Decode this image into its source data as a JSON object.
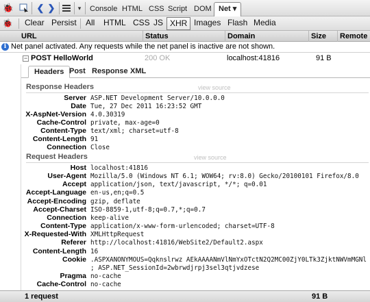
{
  "toolbar": {
    "panels": [
      "Console",
      "HTML",
      "CSS",
      "Script",
      "DOM"
    ],
    "active_panel": "Net",
    "active_panel_arrow": "▾",
    "icons": [
      "firebug-icon",
      "inspect-icon",
      "back-icon",
      "forward-icon",
      "menu-icon",
      "dropdown-icon"
    ]
  },
  "filters": {
    "clear": "Clear",
    "persist": "Persist",
    "types": [
      "All",
      "HTML",
      "CSS",
      "JS",
      "XHR",
      "Images",
      "Flash",
      "Media"
    ],
    "selected": "XHR"
  },
  "columns": {
    "url": "URL",
    "status": "Status",
    "domain": "Domain",
    "size": "Size",
    "remote_ip": "Remote IP"
  },
  "info_message": "Net panel activated. Any requests while the net panel is inactive are not shown.",
  "request": {
    "method_url": "POST HelloWorld",
    "status": "200 OK",
    "domain": "localhost:41816",
    "size": "91 B"
  },
  "detail_tabs": [
    "Headers",
    "Post",
    "Response",
    "XML"
  ],
  "detail_tab_selected": "Headers",
  "response_headers": {
    "title": "Response Headers",
    "view_source": "view source",
    "rows": [
      {
        "name": "Server",
        "value": "ASP.NET Development Server/10.0.0.0"
      },
      {
        "name": "Date",
        "value": "Tue, 27 Dec 2011 16:23:52 GMT"
      },
      {
        "name": "X-AspNet-Version",
        "value": "4.0.30319"
      },
      {
        "name": "Cache-Control",
        "value": "private, max-age=0"
      },
      {
        "name": "Content-Type",
        "value": "text/xml; charset=utf-8"
      },
      {
        "name": "Content-Length",
        "value": "91"
      },
      {
        "name": "Connection",
        "value": "Close"
      }
    ]
  },
  "request_headers": {
    "title": "Request Headers",
    "view_source": "view source",
    "rows": [
      {
        "name": "Host",
        "value": "localhost:41816"
      },
      {
        "name": "User-Agent",
        "value": "Mozilla/5.0 (Windows NT 6.1; WOW64; rv:8.0) Gecko/20100101 Firefox/8.0"
      },
      {
        "name": "Accept",
        "value": "application/json, text/javascript, */*; q=0.01"
      },
      {
        "name": "Accept-Language",
        "value": "en-us,en;q=0.5"
      },
      {
        "name": "Accept-Encoding",
        "value": "gzip, deflate"
      },
      {
        "name": "Accept-Charset",
        "value": "ISO-8859-1,utf-8;q=0.7,*;q=0.7"
      },
      {
        "name": "Connection",
        "value": "keep-alive"
      },
      {
        "name": "Content-Type",
        "value": "application/x-www-form-urlencoded; charset=UTF-8"
      },
      {
        "name": "X-Requested-With",
        "value": "XMLHttpRequest"
      },
      {
        "name": "Referer",
        "value": "http://localhost:41816/WebSite2/Default2.aspx"
      },
      {
        "name": "Content-Length",
        "value": "16"
      },
      {
        "name": "Cookie",
        "value": ".ASPXANONYMOUS=Qqknslrwz AEkAAAANmVlNmYxOTctN2Q2MC00ZjY0LTk3ZjktNWVmMGNl",
        "value2": "; ASP.NET_SessionId=2wbrwdjrpj3sel3qtjvdzese"
      },
      {
        "name": "Pragma",
        "value": "no-cache"
      },
      {
        "name": "Cache-Control",
        "value": "no-cache"
      }
    ]
  },
  "statusbar": {
    "count": "1 request",
    "total_size": "91 B"
  }
}
